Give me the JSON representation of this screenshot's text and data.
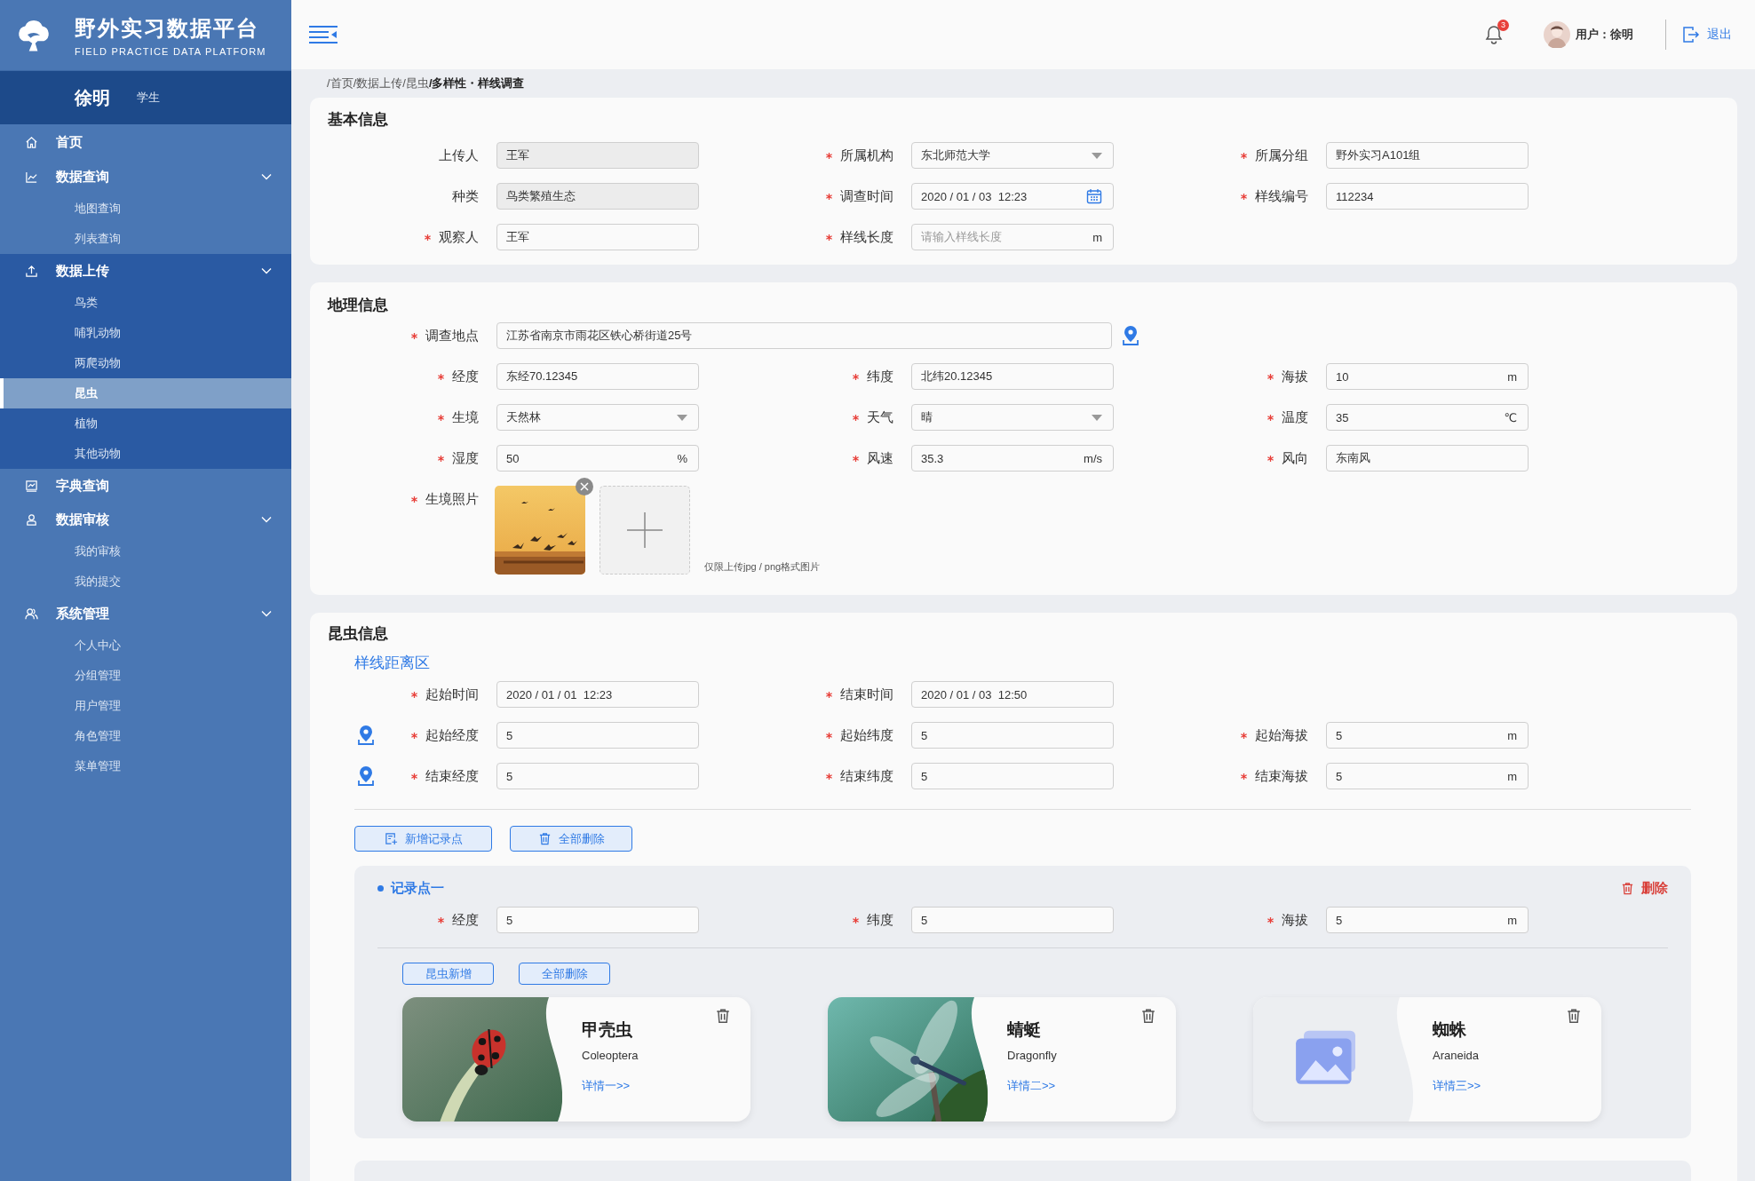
{
  "sidebar": {
    "logo_title": "野外实习数据平台",
    "logo_subtitle": "FIELD PRACTICE DATA PLATFORM",
    "user_name": "徐明",
    "user_role": "学生",
    "menu": [
      {
        "label": "首页",
        "active": false
      },
      {
        "label": "数据查询",
        "active": false,
        "expanded": true,
        "children": [
          {
            "label": "地图查询",
            "selected": false
          },
          {
            "label": "列表查询",
            "selected": false
          }
        ]
      },
      {
        "label": "数据上传",
        "active": true,
        "expanded": true,
        "children": [
          {
            "label": "鸟类",
            "selected": false
          },
          {
            "label": "哺乳动物",
            "selected": false
          },
          {
            "label": "两爬动物",
            "selected": false
          },
          {
            "label": "昆虫",
            "selected": true
          },
          {
            "label": "植物",
            "selected": false
          },
          {
            "label": "其他动物",
            "selected": false
          }
        ]
      },
      {
        "label": "字典查询",
        "active": false
      },
      {
        "label": "数据审核",
        "active": false,
        "expanded": true,
        "children": [
          {
            "label": "我的审核",
            "selected": false
          },
          {
            "label": "我的提交",
            "selected": false
          }
        ]
      },
      {
        "label": "系统管理",
        "active": false,
        "expanded": true,
        "children": [
          {
            "label": "个人中心",
            "selected": false
          },
          {
            "label": "分组管理",
            "selected": false
          },
          {
            "label": "用户管理",
            "selected": false
          },
          {
            "label": "角色管理",
            "selected": false
          },
          {
            "label": "菜单管理",
            "selected": false
          }
        ]
      }
    ]
  },
  "header": {
    "notification_count": "3",
    "user_label": "用户：徐明",
    "logout": "退出"
  },
  "breadcrumb": [
    {
      "label": "/首页",
      "current": false
    },
    {
      "label": "/数据上传",
      "current": false
    },
    {
      "label": "/昆虫",
      "current": false
    },
    {
      "label": "/多样性・样线调查",
      "current": true
    }
  ],
  "basic_info": {
    "title": "基本信息",
    "rows": [
      [
        {
          "label": "上传人",
          "required": false,
          "kind": "text",
          "value": "王军",
          "disabled": true
        },
        {
          "label": "所属机构",
          "required": true,
          "kind": "select",
          "value": "东北师范大学",
          "disabled": false
        },
        {
          "label": "所属分组",
          "required": true,
          "kind": "text",
          "value": "野外实习A101组",
          "disabled": false
        }
      ],
      [
        {
          "label": "种类",
          "required": false,
          "kind": "text",
          "value": "鸟类繁殖生态",
          "disabled": true
        },
        {
          "label": "调查时间",
          "required": true,
          "kind": "date",
          "value": "2020 / 01 / 03  12:23",
          "disabled": false
        },
        {
          "label": "样线编号",
          "required": true,
          "kind": "text",
          "value": "112234",
          "disabled": false
        }
      ],
      [
        {
          "label": "观察人",
          "required": true,
          "kind": "text",
          "value": "王军",
          "disabled": false
        },
        {
          "label": "样线长度",
          "required": true,
          "kind": "text",
          "placeholder": "请输入样线长度",
          "unit": "m",
          "disabled": false
        }
      ]
    ]
  },
  "geo_info": {
    "title": "地理信息",
    "location": {
      "label": "调查地点",
      "required": true,
      "kind": "wide",
      "value": "江苏省南京市雨花区铁心桥街道25号"
    },
    "rows": [
      [
        {
          "label": "经度",
          "required": true,
          "kind": "text",
          "value": "东经70.12345"
        },
        {
          "label": "纬度",
          "required": true,
          "kind": "text",
          "value": "北纬20.12345"
        },
        {
          "label": "海拔",
          "required": true,
          "kind": "text",
          "value": "10",
          "unit": "m"
        }
      ],
      [
        {
          "label": "生境",
          "required": true,
          "kind": "select",
          "value": "天然林"
        },
        {
          "label": "天气",
          "required": true,
          "kind": "select",
          "value": "晴"
        },
        {
          "label": "温度",
          "required": true,
          "kind": "text",
          "value": "35",
          "unit": "℃"
        }
      ],
      [
        {
          "label": "湿度",
          "required": true,
          "kind": "text",
          "value": "50",
          "unit": "%"
        },
        {
          "label": "风速",
          "required": true,
          "kind": "text",
          "value": "35.3",
          "unit": "m/s"
        },
        {
          "label": "风向",
          "required": true,
          "kind": "text",
          "value": "东南风"
        }
      ]
    ],
    "photo": {
      "label": "生境照片",
      "required": true,
      "hint": "仅限上传jpg / png格式图片"
    }
  },
  "insect_info": {
    "title": "昆虫信息",
    "subtitle": "样线距离区",
    "rows": [
      [
        {
          "label": "起始时间",
          "required": true,
          "kind": "text",
          "value": "2020 / 01 / 01  12:23"
        },
        {
          "label": "结束时间",
          "required": true,
          "kind": "text",
          "value": "2020 / 01 / 03  12:50"
        }
      ],
      [
        {
          "label": "起始经度",
          "required": true,
          "kind": "text",
          "value": "5",
          "pin": true
        },
        {
          "label": "起始纬度",
          "required": true,
          "kind": "text",
          "value": "5"
        },
        {
          "label": "起始海拔",
          "required": true,
          "kind": "text",
          "value": "5",
          "unit": "m"
        }
      ],
      [
        {
          "label": "结束经度",
          "required": true,
          "kind": "text",
          "value": "5",
          "pin": true
        },
        {
          "label": "结束纬度",
          "required": true,
          "kind": "text",
          "value": "5"
        },
        {
          "label": "结束海拔",
          "required": true,
          "kind": "text",
          "value": "5",
          "unit": "m"
        }
      ]
    ],
    "buttons": [
      "新增记录点",
      "全部删除"
    ],
    "record_points": [
      {
        "title": "记录点一",
        "delete_label": "删除",
        "rows": [
          [
            {
              "label": "经度",
              "required": true,
              "kind": "text",
              "value": "5"
            },
            {
              "label": "纬度",
              "required": true,
              "kind": "text",
              "value": "5"
            },
            {
              "label": "海拔",
              "required": true,
              "kind": "text",
              "value": "5",
              "unit": "m"
            }
          ]
        ],
        "buttons": [
          "昆虫新增",
          "全部删除"
        ],
        "insects": [
          {
            "name": "甲壳虫",
            "latin": "Coleoptera",
            "link": "详情一>>",
            "kind": "picture"
          },
          {
            "name": "蜻蜓",
            "latin": "Dragonfly",
            "link": "详情二>>",
            "kind": "picture"
          },
          {
            "name": "蜘蛛",
            "latin": "Araneida",
            "link": "详情三>>",
            "kind": "placeholder"
          }
        ]
      }
    ]
  }
}
